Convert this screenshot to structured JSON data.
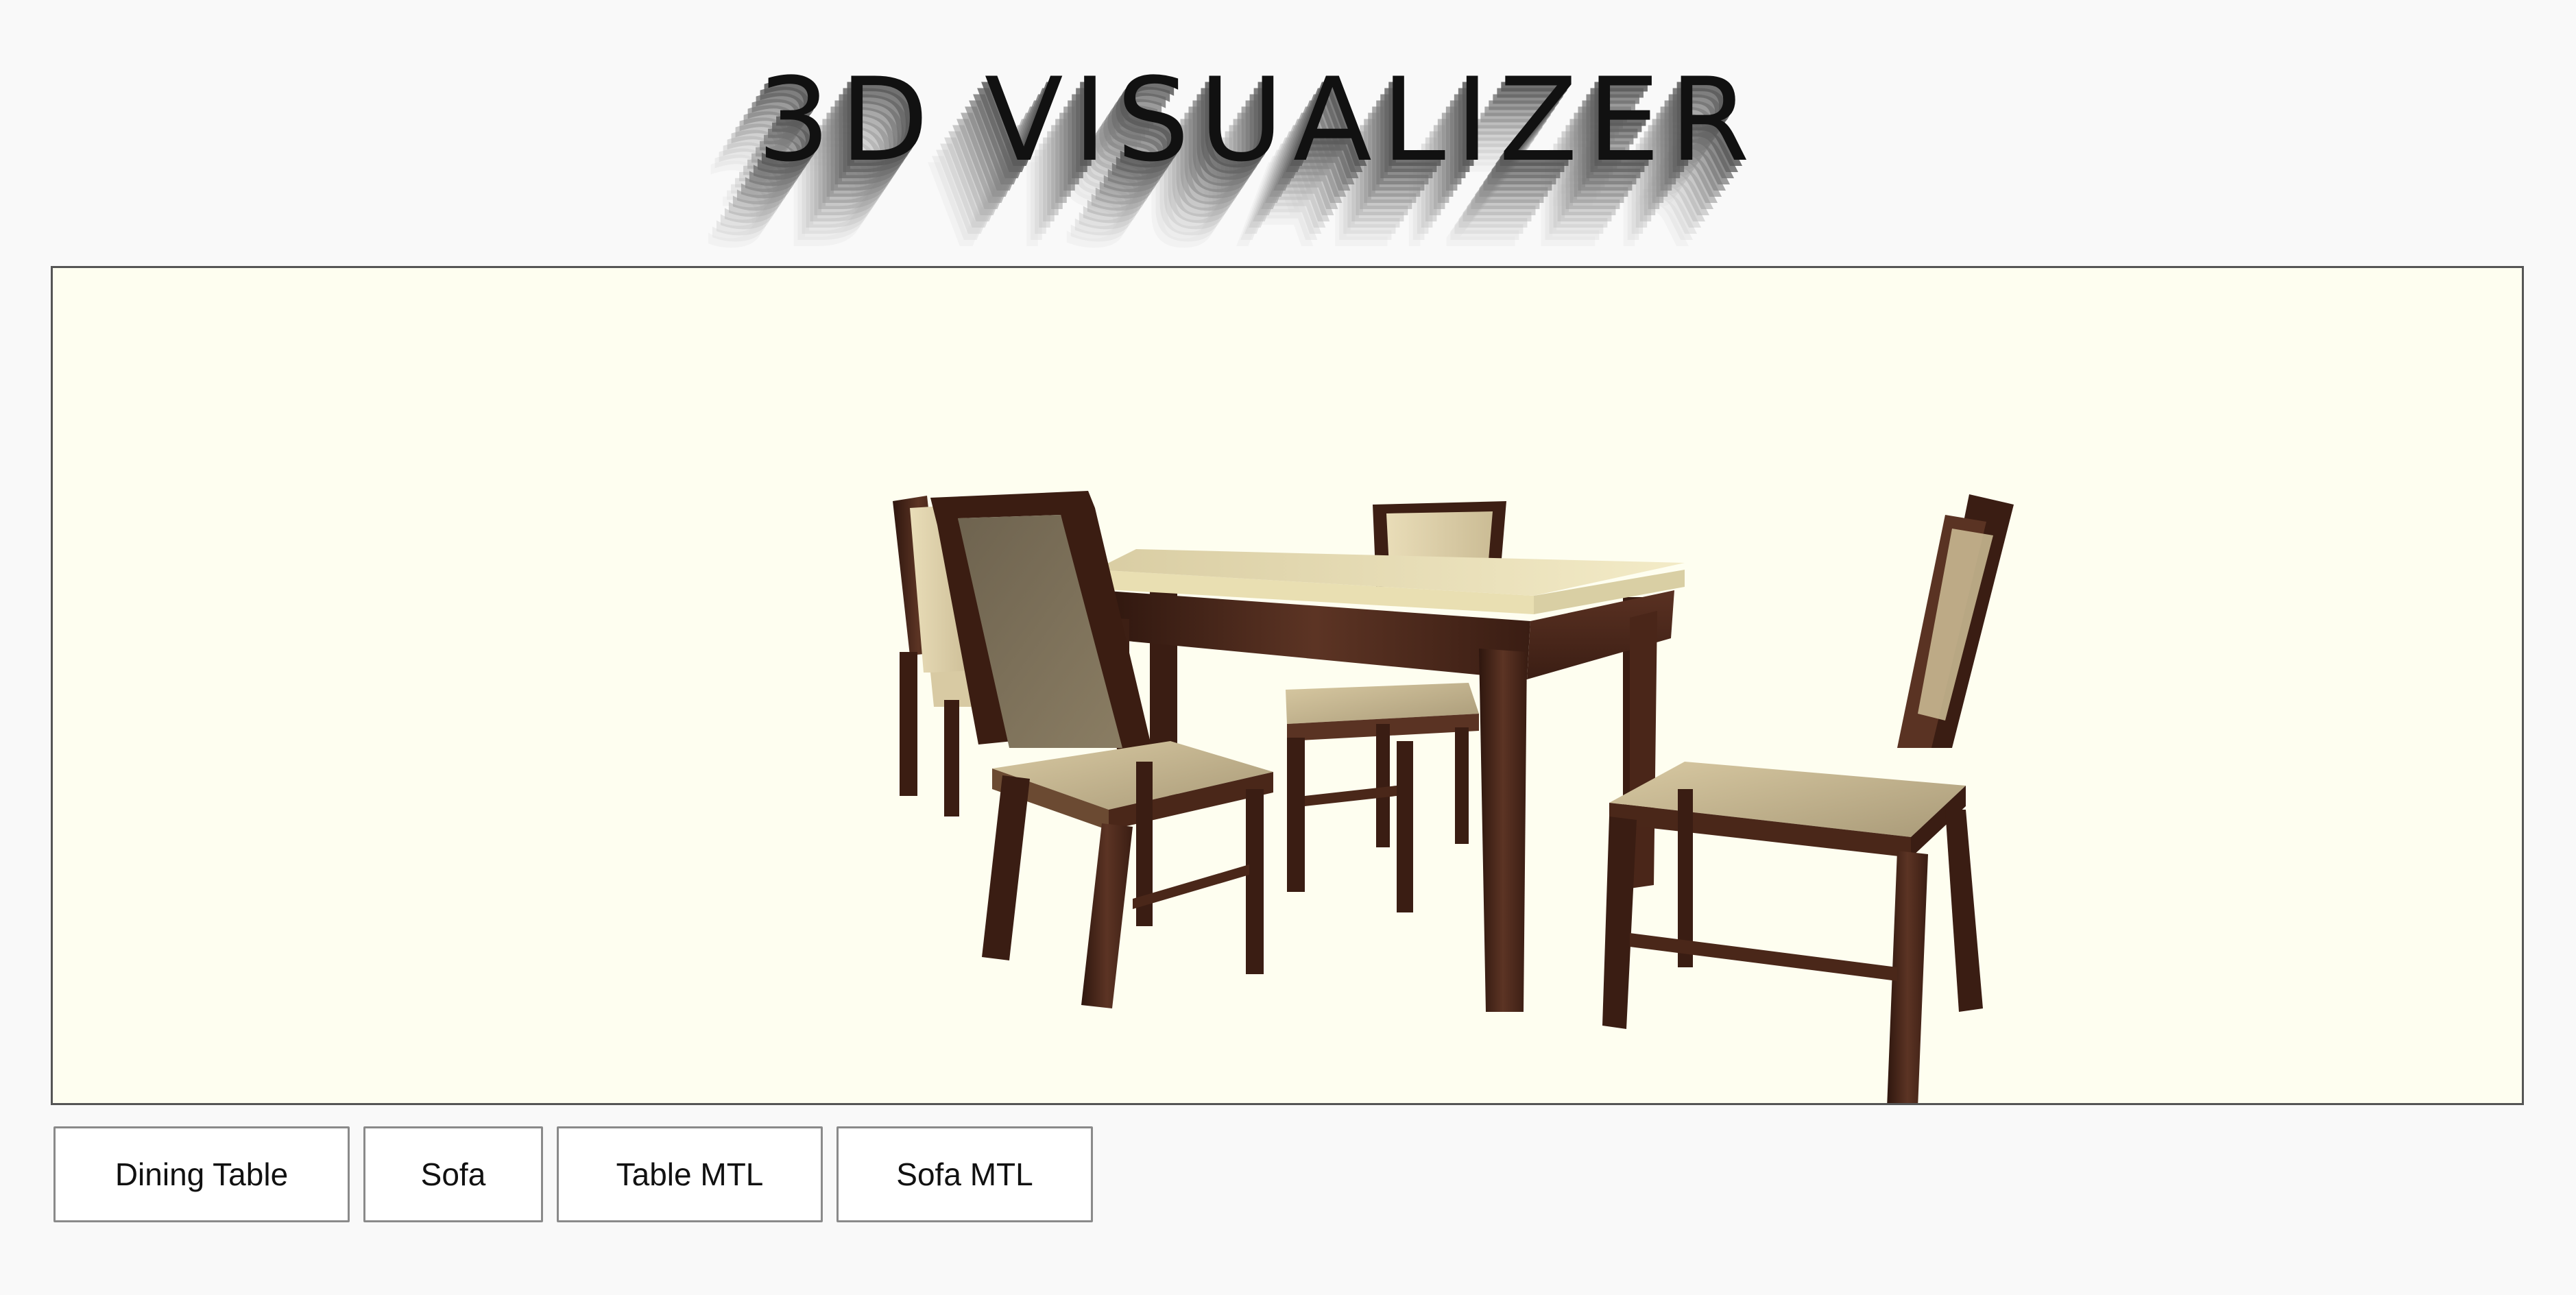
{
  "app": {
    "title": "3D VISUALIZER"
  },
  "viewer": {
    "background": "#fefef0",
    "border": "#555555",
    "scene_content": "dining-set"
  },
  "colors": {
    "wood_dark": "#3a1f15",
    "wood_mid": "#5a3323",
    "wood_light": "#6e4330",
    "tabletop": "#ece2b8",
    "cushion": "#cfbf98",
    "backrest": "#7a6e58"
  },
  "toolbar": {
    "buttons": [
      {
        "label": "Dining Table"
      },
      {
        "label": "Sofa"
      },
      {
        "label": "Table MTL"
      },
      {
        "label": "Sofa MTL"
      }
    ]
  }
}
